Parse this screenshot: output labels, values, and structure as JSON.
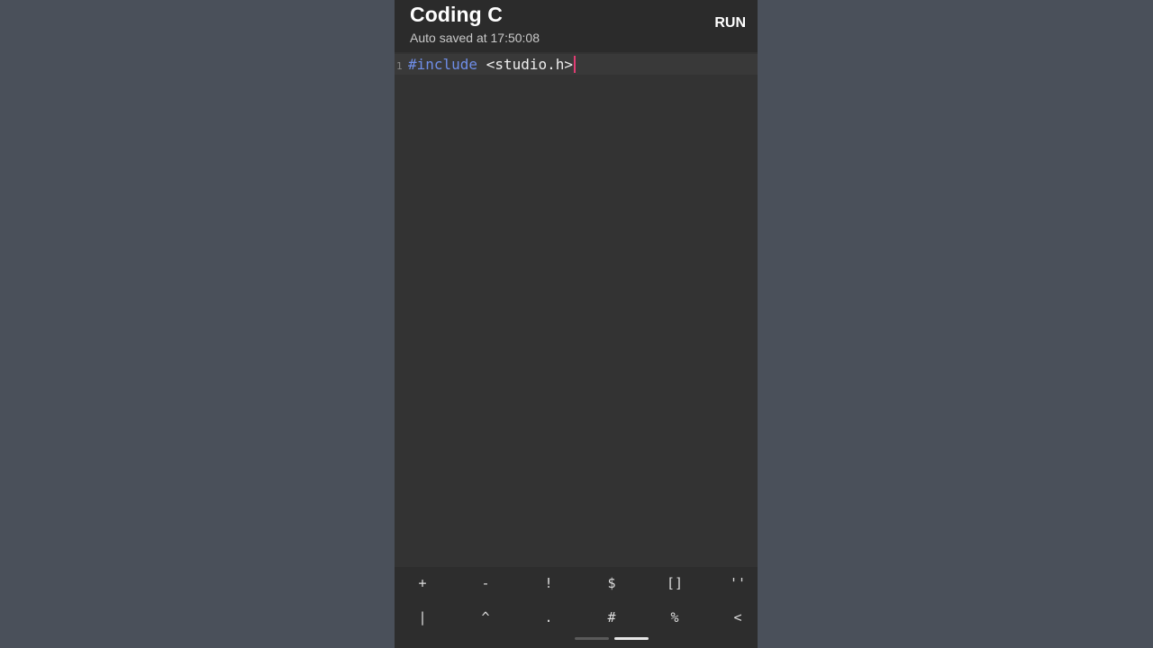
{
  "app": {
    "title": "Coding C",
    "subtitle": "Auto saved at 17:50:08",
    "run_label": "RUN"
  },
  "editor": {
    "lines": [
      {
        "number": "1",
        "keyword": "#include",
        "rest": " <studio.h>"
      }
    ]
  },
  "keyboard": {
    "row1": [
      "+",
      "-",
      "!",
      "$",
      "[]",
      "''"
    ],
    "row2": [
      "|",
      "^",
      ".",
      "#",
      "%",
      "<"
    ]
  },
  "colors": {
    "background": "#4a505a",
    "editor_bg": "#333333",
    "keyword": "#6f8ee8",
    "cursor": "#e03c73"
  }
}
